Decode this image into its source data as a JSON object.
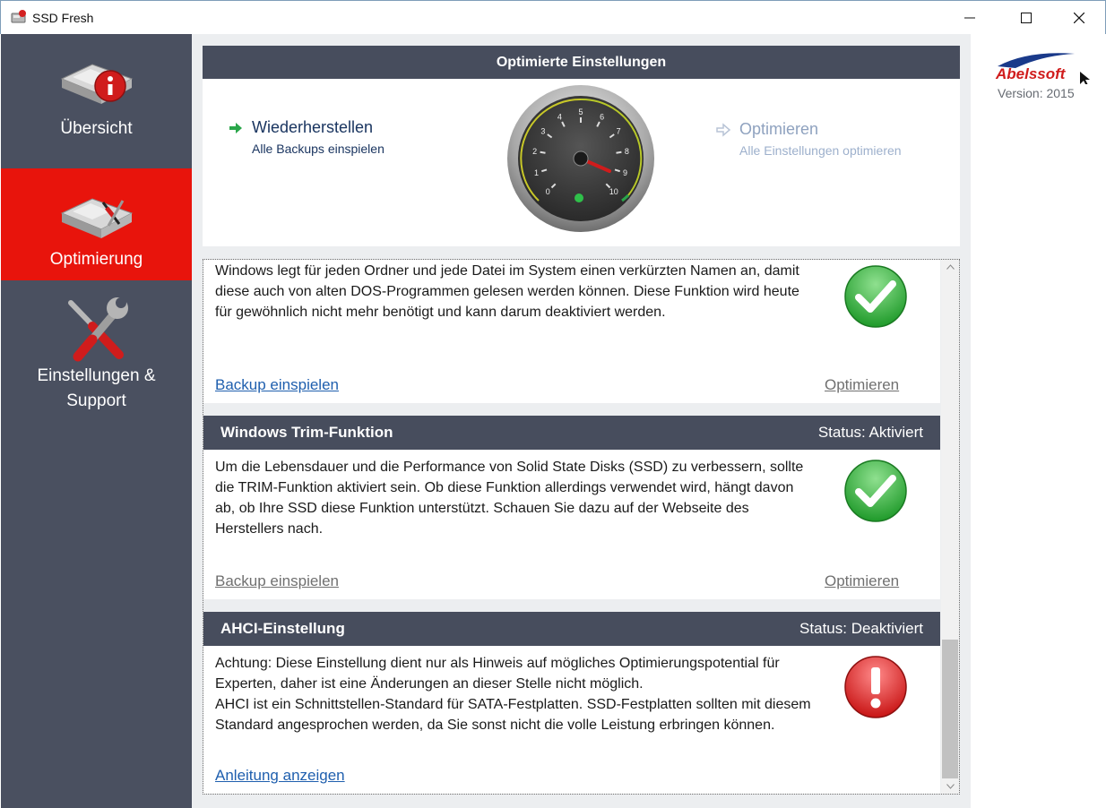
{
  "window": {
    "title": "SSD Fresh"
  },
  "sidebar": {
    "items": [
      {
        "label": "Übersicht",
        "icon": "ssd-info-icon"
      },
      {
        "label": "Optimierung",
        "icon": "ssd-tools-icon"
      },
      {
        "label_line1": "Einstellungen &",
        "label_line2": "Support",
        "icon": "wrench-screwdriver-icon"
      }
    ],
    "active_index": 1
  },
  "gauge_panel": {
    "title": "Optimierte Einstellungen",
    "restore": {
      "title": "Wiederherstellen",
      "subtitle": "Alle Backups einspielen"
    },
    "optimize": {
      "title": "Optimieren",
      "subtitle": "Alle Einstellungen optimieren"
    },
    "gauge_ticks": [
      "0",
      "1",
      "2",
      "3",
      "4",
      "5",
      "6",
      "7",
      "8",
      "9",
      "10"
    ],
    "gauge_needle_value": 9
  },
  "cards": [
    {
      "description": "Windows legt für jeden Ordner und jede Datei im System einen verkürzten Namen an, damit diese auch von alten DOS-Programmen gelesen werden können. Diese Funktion wird heute für gewöhnlich nicht mehr benötigt und kann darum deaktiviert werden.",
      "status_icon": "check-icon",
      "left_link": "Backup einspielen",
      "right_link": "Optimieren"
    },
    {
      "title": "Windows Trim-Funktion",
      "status": "Status: Aktiviert",
      "description": "Um die Lebensdauer und die Performance von Solid State Disks (SSD) zu verbessern, sollte die TRIM-Funktion aktiviert sein. Ob diese Funktion allerdings verwendet wird, hängt davon ab, ob Ihre SSD diese Funktion unterstützt. Schauen Sie dazu auf der Webseite des Herstellers nach.",
      "status_icon": "check-icon",
      "left_link": "Backup einspielen",
      "right_link": "Optimieren"
    },
    {
      "title": "AHCI-Einstellung",
      "status": "Status: Deaktiviert",
      "description_line1": "Achtung: Diese Einstellung dient nur als Hinweis auf mögliches Optimierungspotential für Experten, daher ist eine Änderungen an dieser Stelle nicht möglich.",
      "description_line2": "AHCI ist ein Schnittstellen-Standard für SATA-Festplatten. SSD-Festplatten sollten mit diesem Standard angesprochen werden, da Sie sonst nicht die volle Leistung erbringen können.",
      "status_icon": "warning-icon",
      "left_link": "Anleitung anzeigen"
    }
  ],
  "brand": {
    "logo_text": "Abelssoft",
    "version": "Version: 2015"
  },
  "colors": {
    "sidebar_bg": "#4a5060",
    "sidebar_active": "#e8140c",
    "header_bg": "#474d5d",
    "link": "#1f5fae"
  }
}
